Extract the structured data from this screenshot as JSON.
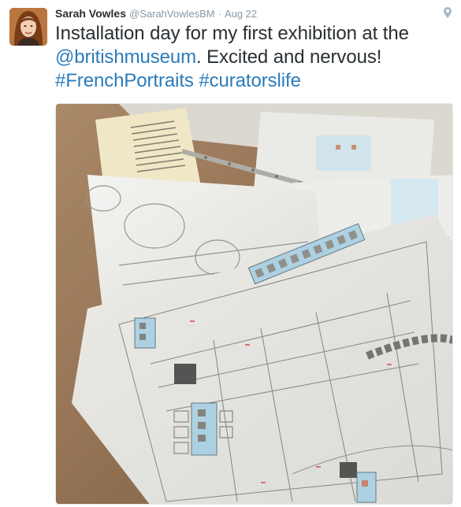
{
  "tweet": {
    "author_name": "Sarah Vowles",
    "author_handle": "@SarahVowlesBM",
    "separator": "·",
    "timestamp": "Aug 22",
    "text_line1": "Installation day for my first exhibition at the",
    "mention": "@britishmuseum",
    "text_line2_rest": ". Excited and nervous!",
    "hashtag1": "#FrenchPortraits",
    "hashtag2": "#curatorslife"
  },
  "icons": {
    "avatar": "profile-photo",
    "geo": "location-pin-icon",
    "media": "photo-of-exhibition-floor-plans"
  },
  "colors": {
    "link": "#2b7bb9",
    "muted": "#8899a6",
    "text": "#292f33"
  }
}
